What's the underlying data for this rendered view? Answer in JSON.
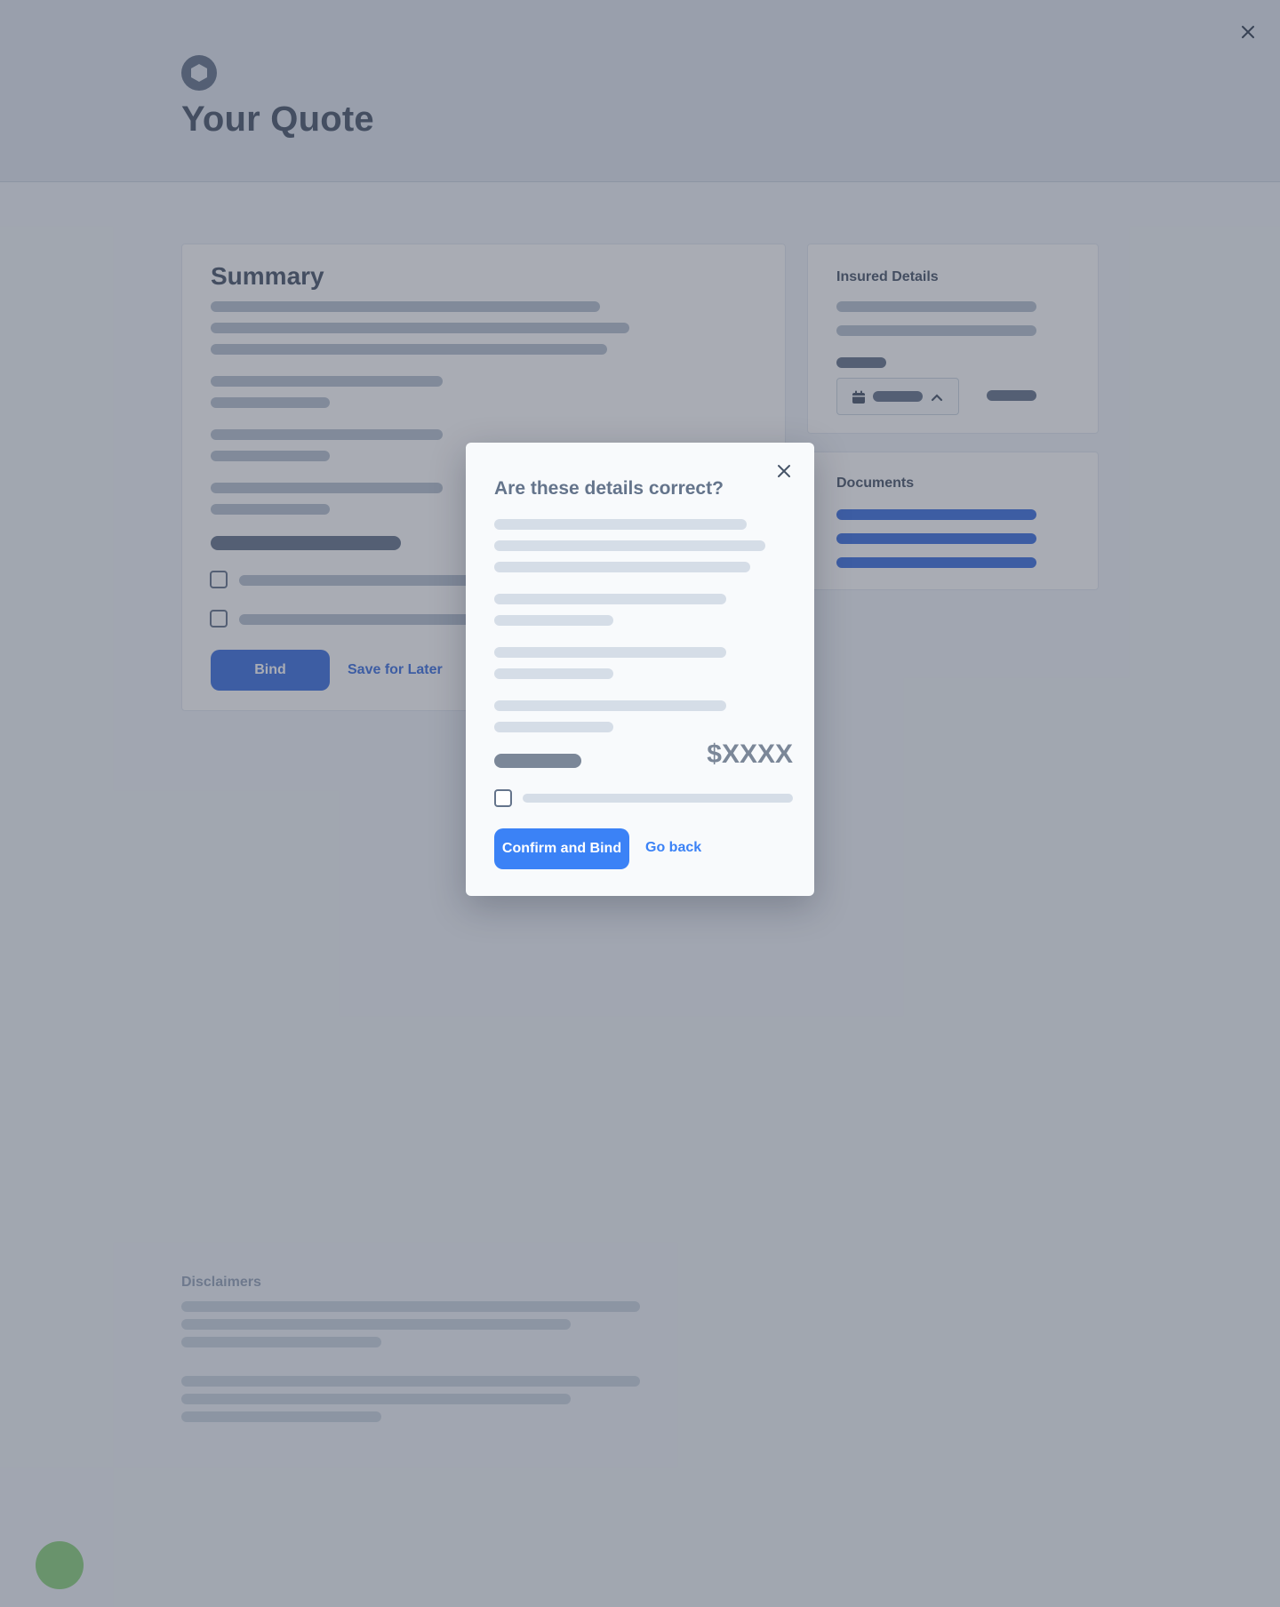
{
  "header": {
    "title": "Your Quote",
    "logo_icon": "hexagon-logo-icon",
    "close_icon": "close-icon"
  },
  "summary": {
    "title": "Summary",
    "bind_label": "Bind",
    "save_label": "Save for Later"
  },
  "insured_details": {
    "heading": "Insured Details",
    "date_select_icon": "calendar-icon",
    "chevron_icon": "chevron-up-icon"
  },
  "documents": {
    "heading": "Documents"
  },
  "disclaimers": {
    "title": "Disclaimers"
  },
  "modal": {
    "title": "Are these details correct?",
    "price": "$XXXX",
    "confirm_label": "Confirm and Bind",
    "go_back_label": "Go back",
    "close_icon": "close-icon"
  },
  "colors": {
    "primary": "#3b82f6",
    "primary_dark": "#3b6fe0",
    "chat": "#8bd17c",
    "overlay": "#404758"
  }
}
